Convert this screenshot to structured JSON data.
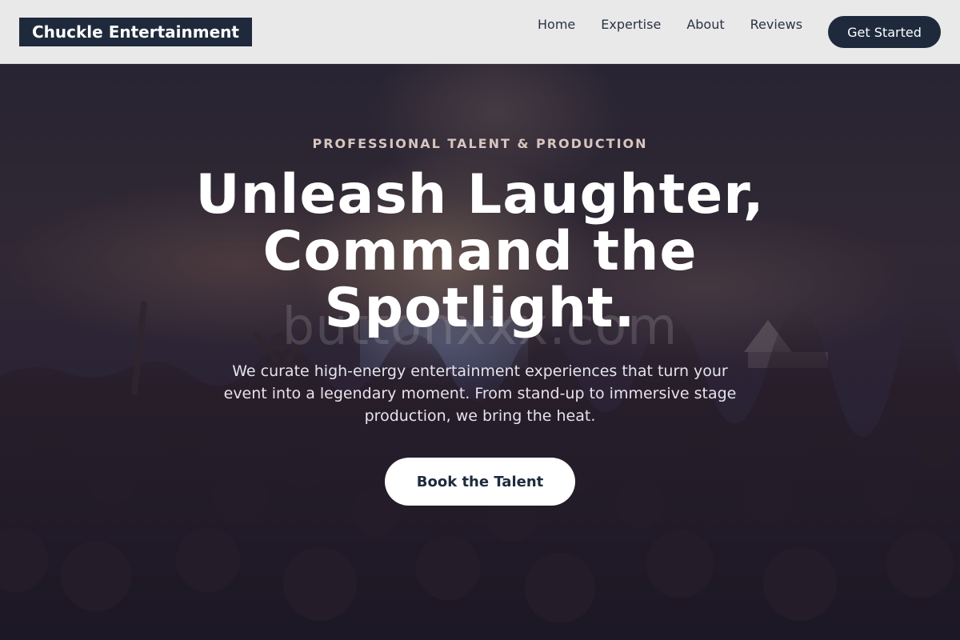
{
  "brand": {
    "logo_text": "Chuckle Entertainment"
  },
  "nav": {
    "links": [
      "Home",
      "Expertise",
      "About",
      "Reviews"
    ],
    "cta_label": "Get Started"
  },
  "hero": {
    "eyebrow": "PROFESSIONAL TALENT & PRODUCTION",
    "headline": "Unleash Laughter, Command the Spotlight.",
    "subtext": "We curate high-energy entertainment experiences that turn your event into a legendary moment. From stand-up to immersive stage production, we bring the heat.",
    "button_label": "Book the Talent",
    "watermark": "buttonxxx.com"
  },
  "colors": {
    "navy": "#1e2a3c",
    "navbar_bg": "#e9e9ea",
    "hero_overlay": "#1e1b2d",
    "white": "#ffffff"
  }
}
